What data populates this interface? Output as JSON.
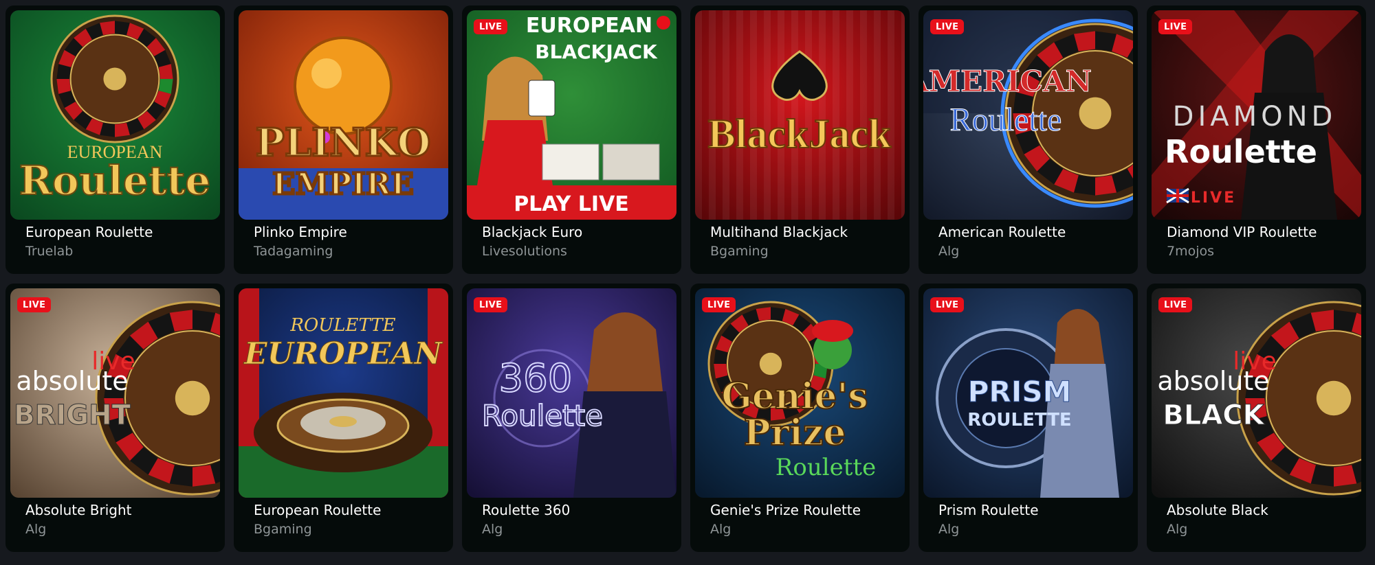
{
  "games": [
    {
      "title": "European Roulette",
      "provider": "Truelab",
      "live": false,
      "art": [
        "EUROPEAN",
        "Roulette"
      ],
      "colors": {
        "bg1": "#1b8a3a",
        "bg2": "#0b4a20",
        "text": "#f2c75a"
      }
    },
    {
      "title": "Plinko Empire",
      "provider": "Tadagaming",
      "live": false,
      "art": [
        "PLINKO",
        "EMPIRE"
      ],
      "colors": {
        "bg1": "#e0561a",
        "bg2": "#7a1e08",
        "text": "#f4d27a"
      }
    },
    {
      "title": "Blackjack Euro",
      "provider": "Livesolutions",
      "live": true,
      "art": [
        "EUROPEAN",
        "BLACKJACK",
        "PLAY LIVE"
      ],
      "colors": {
        "bg1": "#2f8f38",
        "bg2": "#125a22",
        "text": "#ffffff"
      }
    },
    {
      "title": "Multihand Blackjack",
      "provider": "Bgaming",
      "live": false,
      "art": [
        "BlackJack"
      ],
      "colors": {
        "bg1": "#d4161c",
        "bg2": "#5a0608",
        "text": "#f4c75a"
      }
    },
    {
      "title": "American Roulette",
      "provider": "Alg",
      "live": true,
      "art": [
        "AMERICAN",
        "Roulette"
      ],
      "colors": {
        "bg1": "#3a4a66",
        "bg2": "#131a2a",
        "text": "#d32a2a"
      }
    },
    {
      "title": "Diamond VIP Roulette",
      "provider": "7mojos",
      "live": true,
      "art": [
        "DIAMOND",
        "Roulette",
        "LIVE"
      ],
      "colors": {
        "bg1": "#5a1414",
        "bg2": "#1a0606",
        "text": "#ffffff"
      }
    },
    {
      "title": "Absolute Bright",
      "provider": "Alg",
      "live": true,
      "art": [
        "live",
        "absolute",
        "BRIGHT"
      ],
      "colors": {
        "bg1": "#c8b29a",
        "bg2": "#5a4634",
        "text": "#ffffff"
      }
    },
    {
      "title": "European Roulette",
      "provider": "Bgaming",
      "live": false,
      "art": [
        "ROULETTE",
        "EUROPEAN"
      ],
      "colors": {
        "bg1": "#1c3a8a",
        "bg2": "#0a1838",
        "text": "#f2c75a"
      }
    },
    {
      "title": "Roulette 360",
      "provider": "Alg",
      "live": true,
      "art": [
        "360",
        "Roulette"
      ],
      "colors": {
        "bg1": "#4a3a9a",
        "bg2": "#161036",
        "text": "#d8d8ff"
      }
    },
    {
      "title": "Genie's Prize Roulette",
      "provider": "Alg",
      "live": true,
      "art": [
        "Genie's",
        "Prize",
        "Roulette"
      ],
      "colors": {
        "bg1": "#1a4a7a",
        "bg2": "#081a2e",
        "text": "#e8c060"
      }
    },
    {
      "title": "Prism Roulette",
      "provider": "Alg",
      "live": true,
      "art": [
        "PRISM",
        "ROULETTE"
      ],
      "colors": {
        "bg1": "#2a4a7a",
        "bg2": "#0c182c",
        "text": "#cfe0ff"
      }
    },
    {
      "title": "Absolute Black",
      "provider": "Alg",
      "live": true,
      "art": [
        "live",
        "absolute",
        "BLACK"
      ],
      "colors": {
        "bg1": "#4a4a4a",
        "bg2": "#111111",
        "text": "#ffffff"
      }
    }
  ],
  "live_badge": "LIVE"
}
